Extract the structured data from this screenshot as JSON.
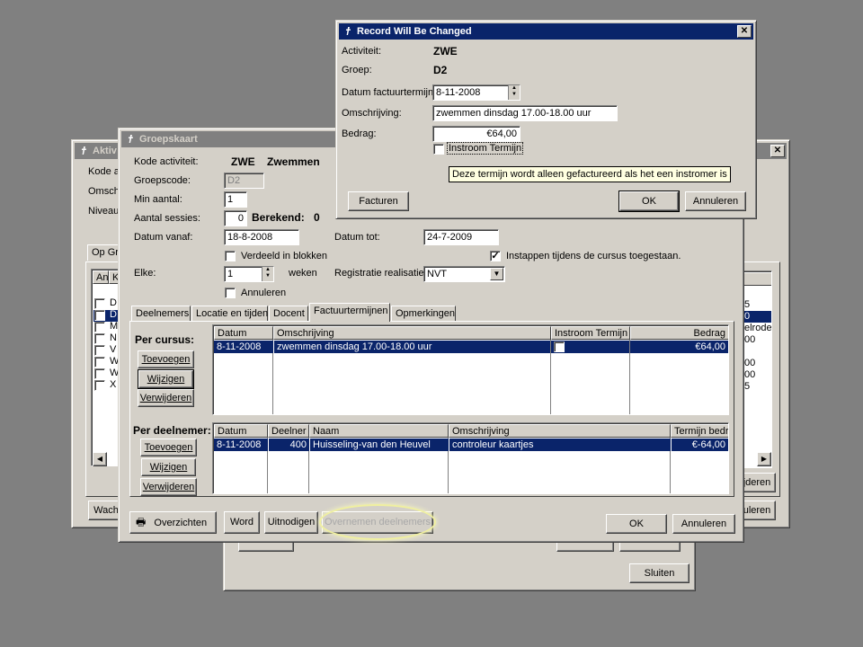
{
  "window_back": {
    "title": "",
    "sluiten": "Sluiten"
  },
  "window_aktiviteit": {
    "title": "Aktiv",
    "labels": [
      "Kode a",
      "Omsch",
      "Niveau"
    ],
    "tab": "Op Gr",
    "list_header": [
      "An",
      "K"
    ],
    "list_codes": [
      "D",
      "D",
      "M",
      "N",
      "V",
      "W",
      "W",
      "X"
    ],
    "right_values": [
      "5",
      "0",
      "elrode",
      "00",
      "00",
      "00",
      "5"
    ],
    "wach": "Wach",
    "jderen": "jderen",
    "uleren": "uleren"
  },
  "groepskaart": {
    "title": "Groepskaart",
    "kode_activiteit_label": "Kode activiteit:",
    "kode_activiteit_code": "ZWE",
    "kode_activiteit_name": "Zwemmen",
    "groepscode_label": "Groepscode:",
    "groepscode_value": "D2",
    "min_aantal_label": "Min aantal:",
    "min_aantal_value": "1",
    "aantal_sessies_label": "Aantal sessies:",
    "aantal_sessies_value": "0",
    "berekend_label": "Berekend:",
    "berekend_value": "0",
    "datum_vanaf_label": "Datum vanaf:",
    "datum_vanaf_value": "18-8-2008",
    "datum_tot_label": "Datum tot:",
    "datum_tot_value": "24-7-2009",
    "verdeeld_label": "Verdeeld in blokken",
    "instappen_label": "Instappen tijdens de cursus toegestaan.",
    "elke_label": "Elke:",
    "elke_value": "1",
    "weken_label": "weken",
    "registratie_label": "Registratie realisatie:",
    "registratie_value": "NVT",
    "annuleren_check_label": "Annuleren",
    "tabs": [
      "Deelnemers",
      "Locatie en tijden",
      "Docent",
      "Factuurtermijnen",
      "Opmerkingen"
    ],
    "per_cursus_label": "Per cursus:",
    "per_deelnemer_label": "Per deelnemer:",
    "toevoegen": "Toevoegen",
    "wijzigen": "Wijzigen",
    "verwijderen": "Verwijderen",
    "cursus_headers": [
      "Datum",
      "Omschrijving",
      "Instroom Termijn",
      "Bedrag"
    ],
    "cursus_row": {
      "datum": "8-11-2008",
      "omschrijving": "zwemmen dinsdag 17.00-18.00 uur",
      "bedrag": "€64,00"
    },
    "deelnemer_headers": [
      "Datum",
      "Deelner",
      "Naam",
      "Omschrijving",
      "Termijn bedr"
    ],
    "deelnemer_row": {
      "datum": "8-11-2008",
      "deelnemer": "400",
      "naam": "Huisseling-van den Heuvel",
      "omschrijving": "controleur kaartjes",
      "termijn": "€-64,00"
    },
    "overzichten": "Overzichten",
    "word": "Word",
    "uitnodigen": "Uitnodigen",
    "overnemen": "Overnemen deelnemers",
    "ok": "OK",
    "annuleren": "Annuleren"
  },
  "record_dialog": {
    "title": "Record Will Be Changed",
    "activiteit_label": "Activiteit:",
    "activiteit_value": "ZWE",
    "groep_label": "Groep:",
    "groep_value": "D2",
    "datum_label": "Datum factuurtermijn:",
    "datum_value": "8-11-2008",
    "omschrijving_label": "Omschrijving:",
    "omschrijving_value": "zwemmen dinsdag 17.00-18.00 uur",
    "bedrag_label": "Bedrag:",
    "bedrag_value": "€64,00",
    "instroom_label": "Instroom Termijn",
    "tooltip": "Deze termijn wordt alleen gefactureerd als het een instromer is",
    "facturen": "Facturen",
    "ok": "OK",
    "annuleren": "Annuleren"
  }
}
